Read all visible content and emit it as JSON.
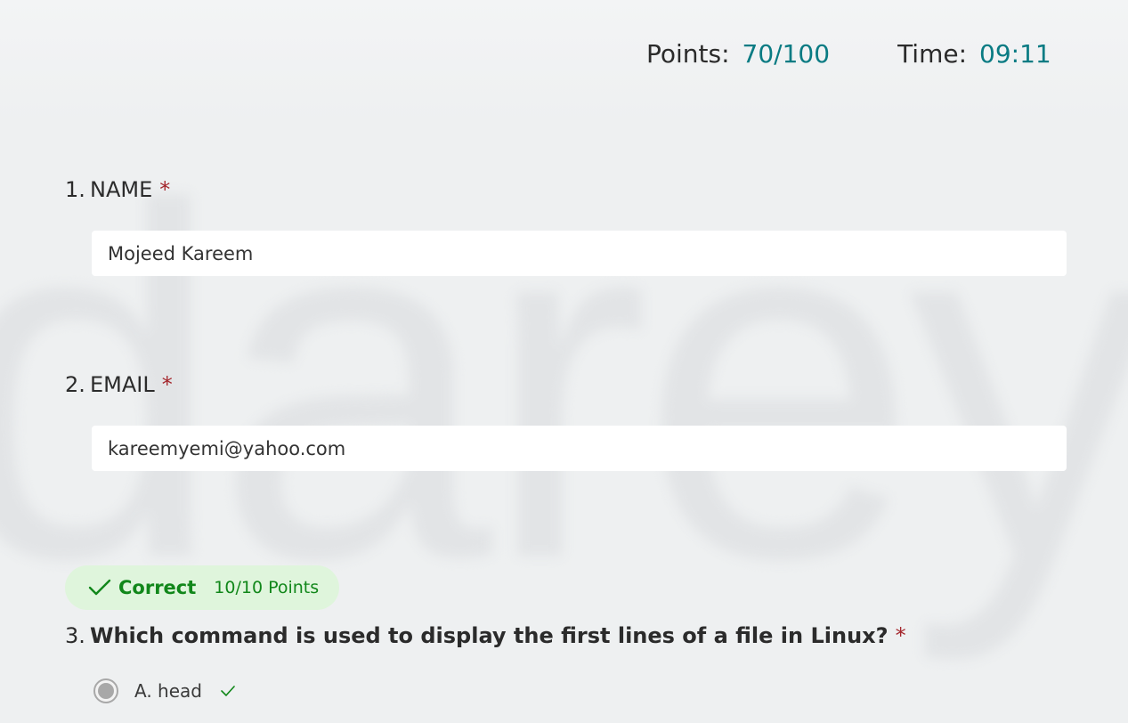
{
  "background": {
    "watermark_text": "darey"
  },
  "score": {
    "points_label": "Points:",
    "points_value": "70/100",
    "time_label": "Time:",
    "time_value": "09:11"
  },
  "questions": [
    {
      "number": "1.",
      "title": "NAME",
      "required_mark": "*",
      "answer": "Mojeed Kareem"
    },
    {
      "number": "2.",
      "title": "EMAIL",
      "required_mark": "*",
      "answer": "kareemyemi@yahoo.com"
    },
    {
      "number": "3.",
      "title": "Which command is used to display the first lines of a file in Linux?",
      "required_mark": "*",
      "result": {
        "status": "Correct",
        "points": "10/10 Points",
        "icon": "checkmark-icon"
      },
      "options": [
        {
          "label": "A. head",
          "selected": true,
          "correct_icon": "checkmark-icon"
        }
      ]
    }
  ],
  "colors": {
    "accent_teal": "#0a7b83",
    "required_red": "#a4262c",
    "correct_green": "#11871a",
    "correct_badge_bg": "#dff5dc"
  }
}
